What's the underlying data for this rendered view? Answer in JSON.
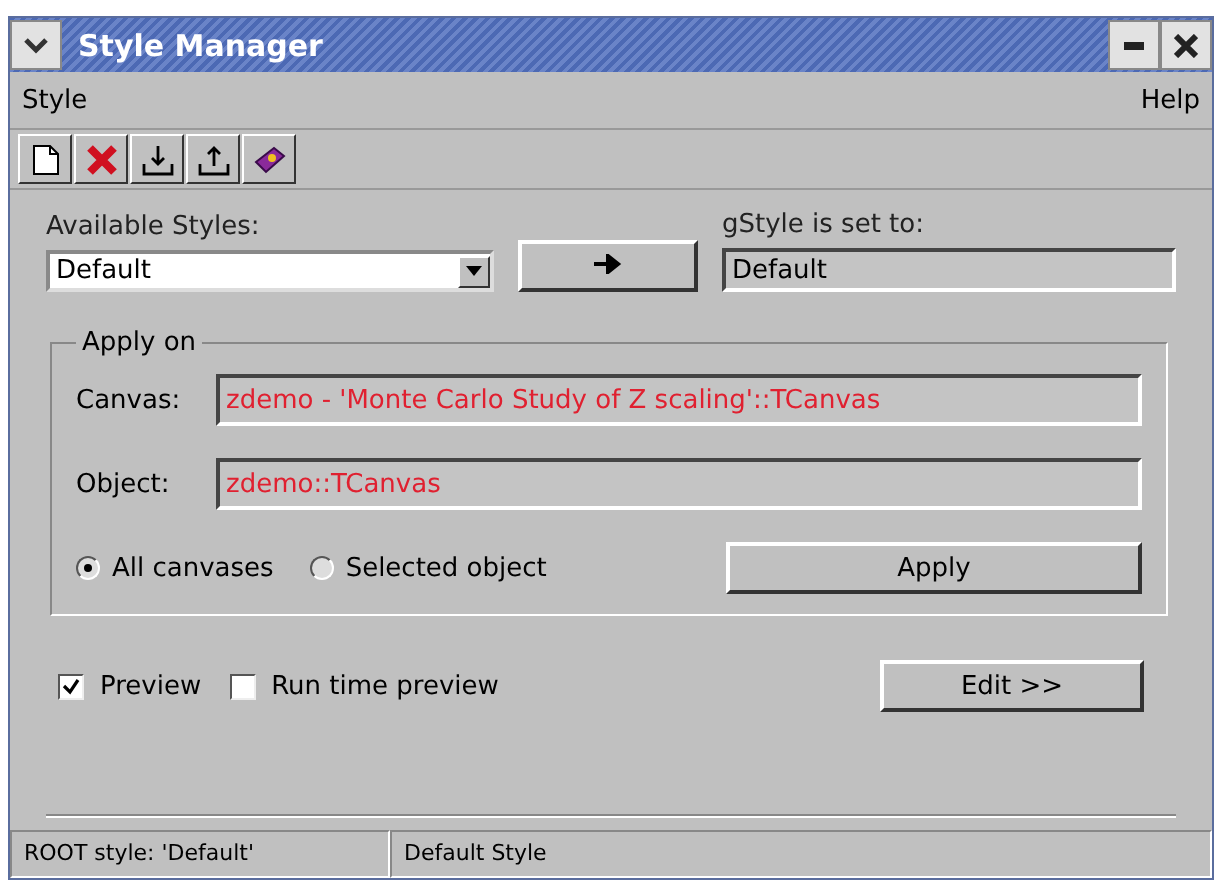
{
  "window": {
    "title": "Style Manager"
  },
  "menu": [
    "Style",
    "Help"
  ],
  "toolbar": [
    {
      "kind": "new"
    },
    {
      "kind": "delete"
    },
    {
      "kind": "import"
    },
    {
      "kind": "export"
    },
    {
      "kind": "help"
    }
  ],
  "available_styles": {
    "label": "Available Styles:",
    "value": "Default"
  },
  "gstyle": {
    "label": "gStyle is set to:",
    "value": "Default"
  },
  "apply_on": {
    "title": "Apply on",
    "canvas_label": "Canvas:",
    "canvas_value": "zdemo - 'Monte Carlo Study of Z scaling'::TCanvas",
    "object_label": "Object:",
    "object_value": "zdemo::TCanvas",
    "options": [
      {
        "label": "All canvases",
        "selected": true
      },
      {
        "label": "Selected object",
        "selected": false
      }
    ],
    "apply_button": "Apply"
  },
  "checks": [
    {
      "label": "Preview",
      "checked": true
    },
    {
      "label": "Run time preview",
      "checked": false
    }
  ],
  "edit_button": "Edit >>",
  "status_bar": [
    "ROOT style: 'Default'",
    "Default Style"
  ]
}
